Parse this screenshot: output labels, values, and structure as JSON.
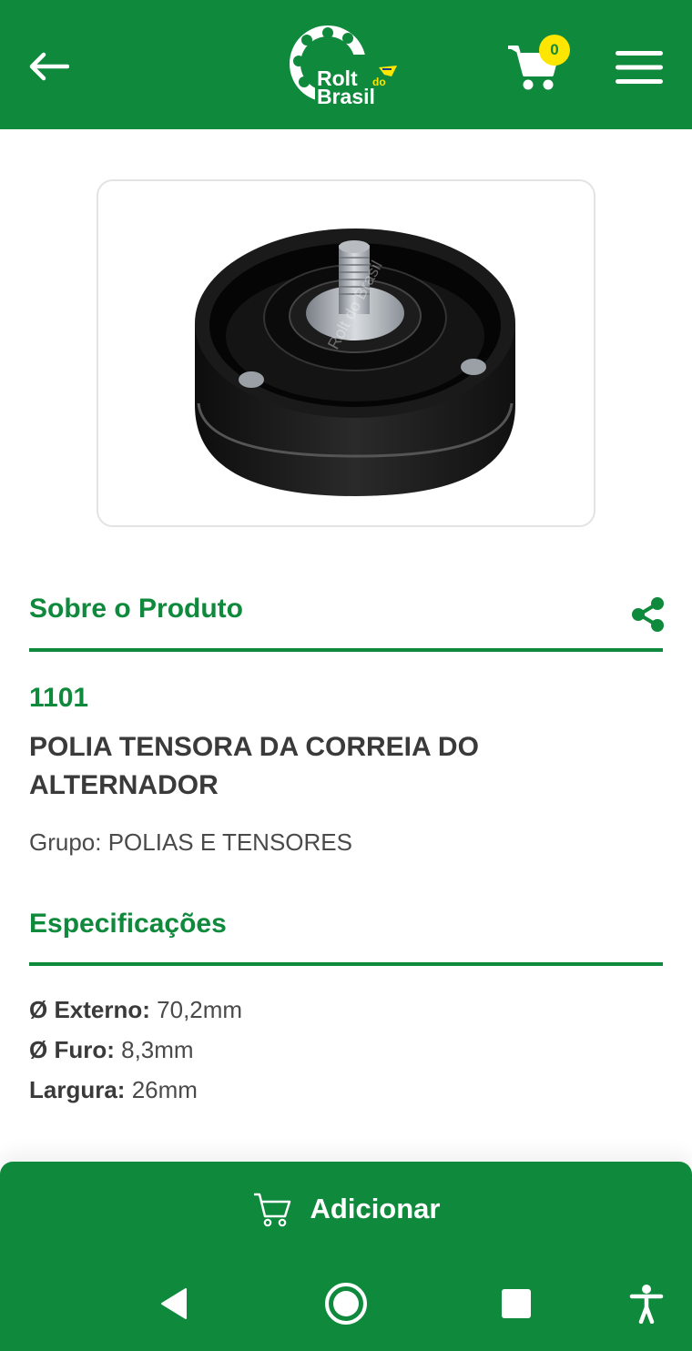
{
  "header": {
    "logo_text_1": "Rolt",
    "logo_text_2": "do",
    "logo_text_3": "Brasil",
    "cart_count": "0"
  },
  "product_image": {
    "watermark": "Rolt do Brasil"
  },
  "about": {
    "title": "Sobre o Produto",
    "code": "1101",
    "name": "POLIA TENSORA DA CORREIA DO ALTERNADOR",
    "group": "Grupo: POLIAS E TENSORES"
  },
  "specs": {
    "title": "Especificações",
    "items": [
      {
        "label": "Ø Externo:",
        "value": "70,2mm"
      },
      {
        "label": "Ø Furo:",
        "value": "8,3mm"
      },
      {
        "label": "Largura:",
        "value": "26mm"
      }
    ]
  },
  "bottom": {
    "add_label": "Adicionar"
  },
  "colors": {
    "brand_green": "#0f8a3c",
    "badge_yellow": "#ffe600"
  },
  "icons": [
    "back-arrow-icon",
    "cart-icon",
    "menu-icon",
    "share-icon",
    "nav-back-icon",
    "nav-home-icon",
    "nav-recents-icon",
    "accessibility-icon"
  ]
}
